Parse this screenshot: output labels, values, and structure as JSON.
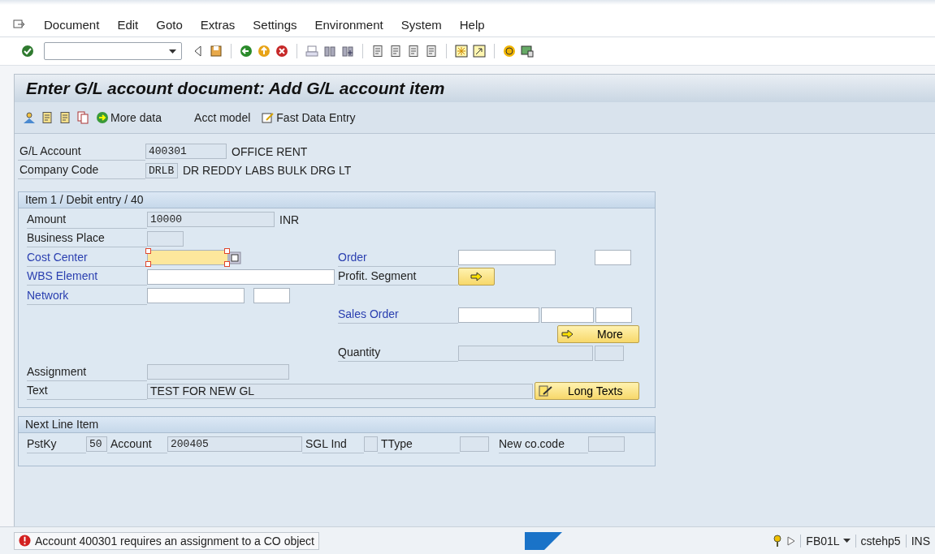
{
  "menu": [
    "Document",
    "Edit",
    "Goto",
    "Extras",
    "Settings",
    "Environment",
    "System",
    "Help"
  ],
  "title": "Enter G/L account document: Add G/L account item",
  "app_toolbar": [
    {
      "label": "More data"
    },
    {
      "label": "Acct model"
    },
    {
      "label": "Fast Data Entry"
    }
  ],
  "header": [
    {
      "label": "G/L Account",
      "value": "400301",
      "description": "OFFICE RENT"
    },
    {
      "label": "Company Code",
      "value": "DRLB",
      "description": "DR REDDY LABS BULK DRG LT"
    }
  ],
  "item": {
    "title": "Item 1 / Debit entry / 40",
    "amount": {
      "label": "Amount",
      "value": "10000",
      "unit": "INR",
      "linked": false
    },
    "business_place": {
      "label": "Business Place",
      "linked": false
    },
    "cost_center": {
      "label": "Cost Center",
      "linked": true,
      "focused": true
    },
    "order": {
      "label": "Order",
      "linked": true
    },
    "wbs_element": {
      "label": "WBS Element",
      "linked": true
    },
    "profit_segment": {
      "label": "Profit. Segment",
      "linked": false
    },
    "network": {
      "label": "Network",
      "linked": true
    },
    "sales_order": {
      "label": "Sales Order",
      "linked": true
    },
    "more_button": {
      "label": "More"
    },
    "quantity": {
      "label": "Quantity",
      "linked": false
    },
    "assignment": {
      "label": "Assignment",
      "linked": false
    },
    "text": {
      "label": "Text",
      "value": "TEST FOR NEW GL",
      "linked": false
    },
    "long_texts_button": {
      "label": "Long Texts"
    }
  },
  "next_line_item": {
    "title": "Next Line Item",
    "posting_key": {
      "label": "PstKy",
      "value": "50"
    },
    "account": {
      "label": "Account",
      "value": "200405"
    },
    "sgl_ind": {
      "label": "SGL Ind"
    },
    "ttype": {
      "label": "TType"
    },
    "new_co_code": {
      "label": "New co.code"
    }
  },
  "status_bar": {
    "message": {
      "kind": "error",
      "text": "Account 400301 requires an assignment to a CO object"
    },
    "transaction": "FB01L",
    "user": "cstehp5",
    "mode": "INS"
  }
}
